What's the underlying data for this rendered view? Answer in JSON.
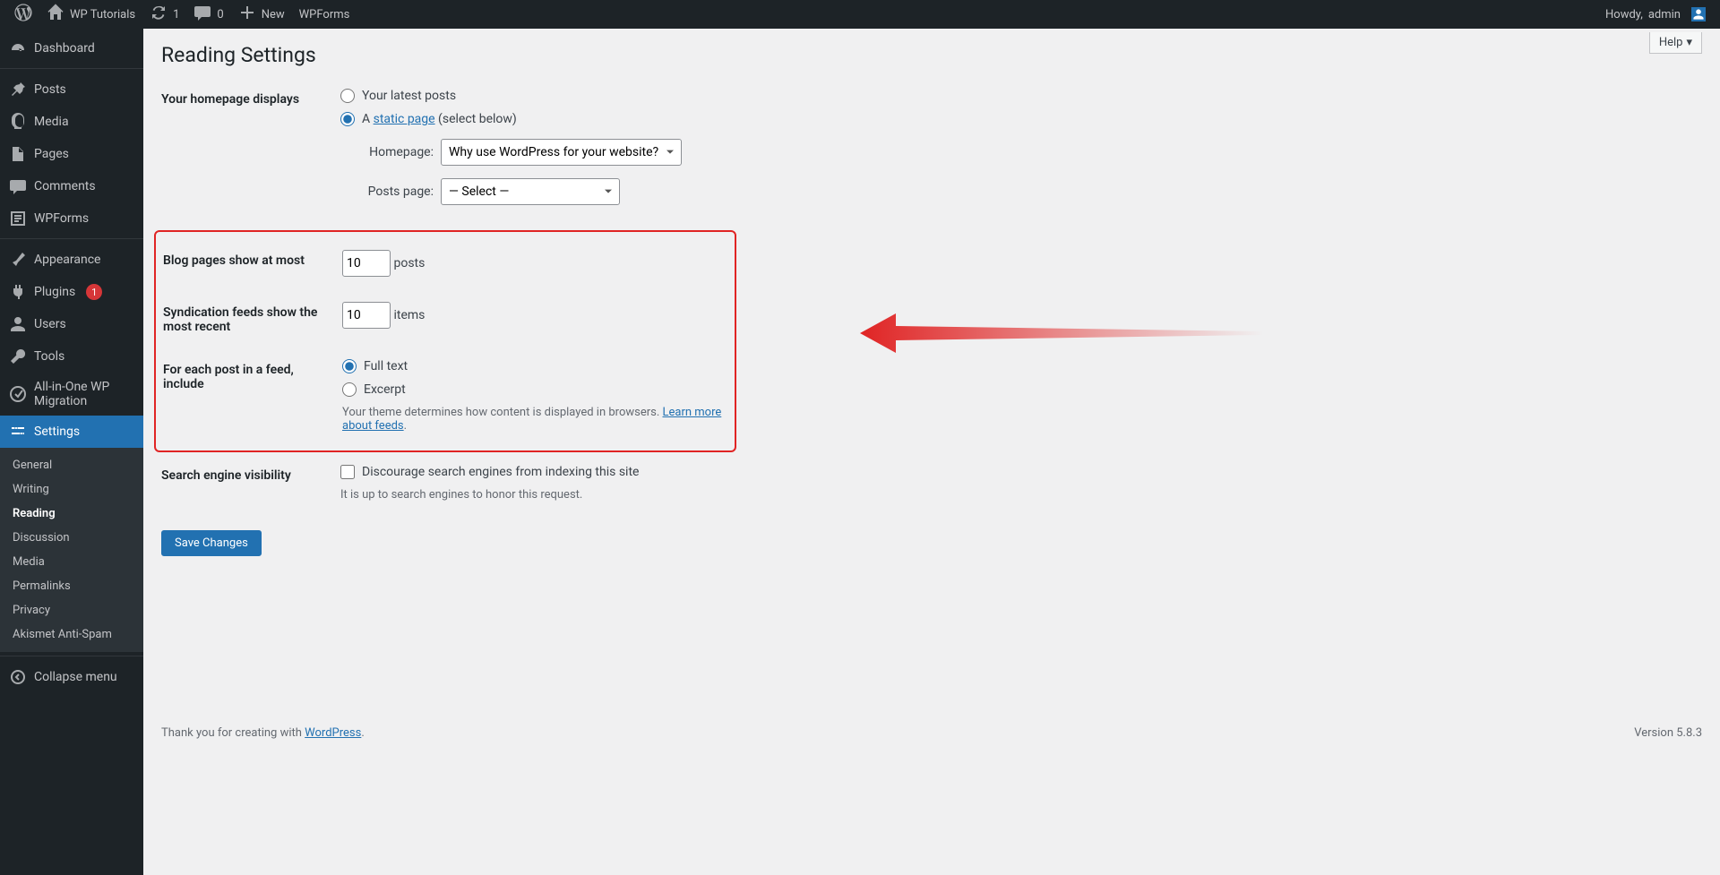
{
  "adminbar": {
    "site_name": "WP Tutorials",
    "updates_count": "1",
    "comments_count": "0",
    "new_label": "New",
    "wpforms_label": "WPForms",
    "howdy_prefix": "Howdy, ",
    "username": "admin"
  },
  "sidebar": {
    "items": [
      {
        "label": "Dashboard"
      },
      {
        "label": "Posts"
      },
      {
        "label": "Media"
      },
      {
        "label": "Pages"
      },
      {
        "label": "Comments"
      },
      {
        "label": "WPForms"
      },
      {
        "label": "Appearance"
      },
      {
        "label": "Plugins",
        "badge": "1"
      },
      {
        "label": "Users"
      },
      {
        "label": "Tools"
      },
      {
        "label": "All-in-One WP Migration"
      },
      {
        "label": "Settings"
      }
    ],
    "settings_sub": [
      "General",
      "Writing",
      "Reading",
      "Discussion",
      "Media",
      "Permalinks",
      "Privacy",
      "Akismet Anti-Spam"
    ],
    "collapse": "Collapse menu"
  },
  "page": {
    "help": "Help",
    "title": "Reading Settings",
    "homepage": {
      "label": "Your homepage displays",
      "opt_latest": "Your latest posts",
      "opt_static_prefix": "A ",
      "opt_static_link": "static page",
      "opt_static_suffix": " (select below)",
      "homepage_label": "Homepage:",
      "homepage_value": "Why use WordPress for your website?",
      "postspage_label": "Posts page:",
      "postspage_value": "— Select —"
    },
    "blog_pages": {
      "label": "Blog pages show at most",
      "value": "10",
      "suffix": "posts"
    },
    "syndication": {
      "label": "Syndication feeds show the most recent",
      "value": "10",
      "suffix": "items"
    },
    "feed_include": {
      "label": "For each post in a feed, include",
      "opt_full": "Full text",
      "opt_excerpt": "Excerpt",
      "desc_prefix": "Your theme determines how content is displayed in browsers. ",
      "desc_link": "Learn more about feeds",
      "desc_suffix": "."
    },
    "search": {
      "label": "Search engine visibility",
      "opt": "Discourage search engines from indexing this site",
      "desc": "It is up to search engines to honor this request."
    },
    "save": "Save Changes",
    "footer_prefix": "Thank you for creating with ",
    "footer_link": "WordPress",
    "footer_suffix": ".",
    "version": "Version 5.8.3"
  }
}
